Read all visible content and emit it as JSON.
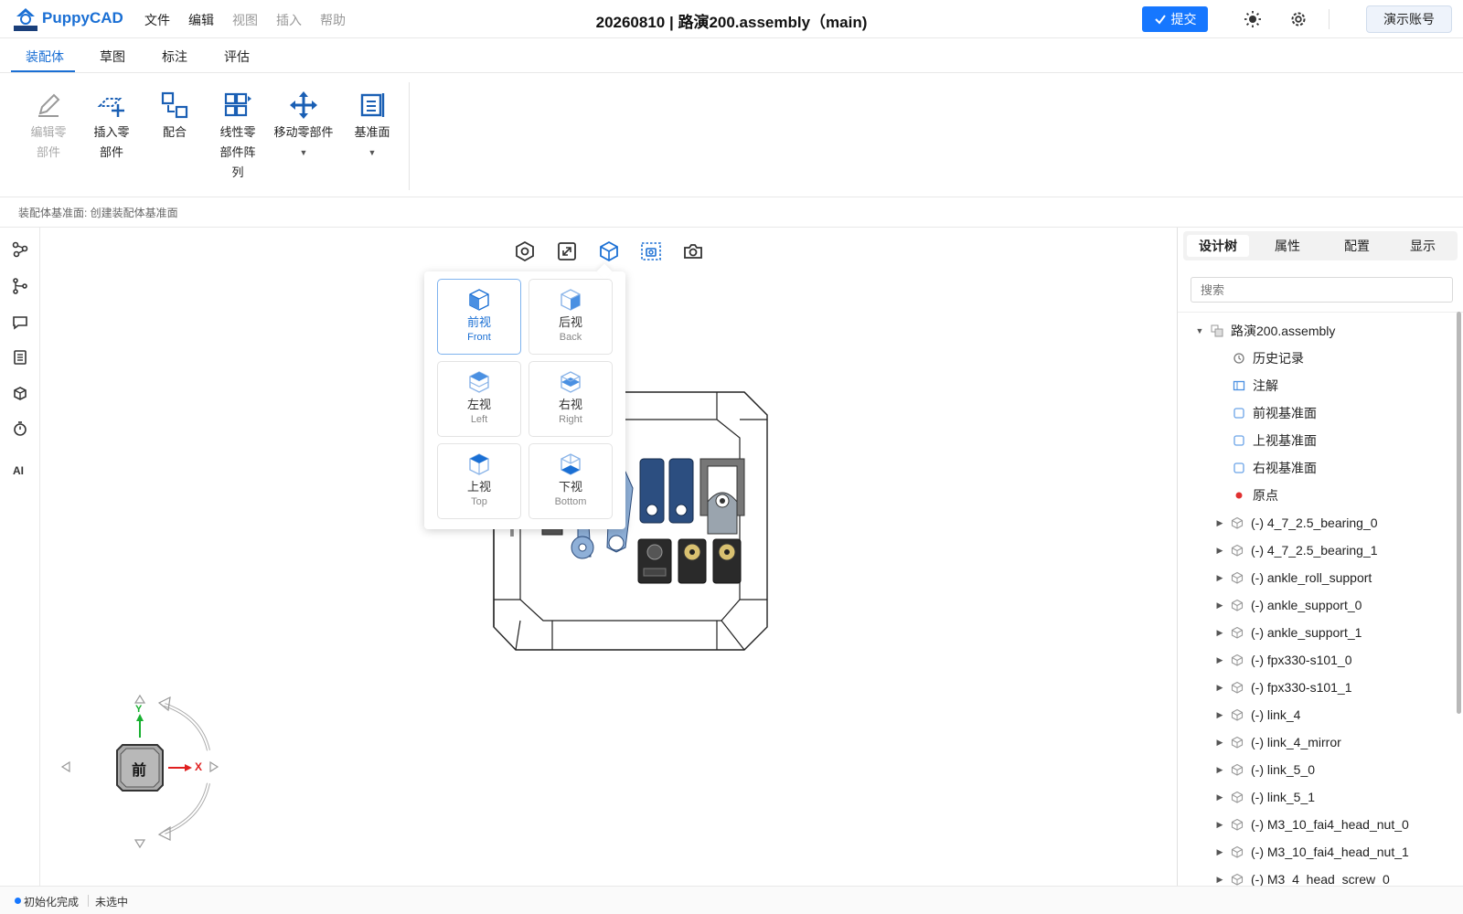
{
  "header": {
    "logo_text": "PuppyCAD",
    "menu": [
      {
        "label": "文件",
        "enabled": true
      },
      {
        "label": "编辑",
        "enabled": true
      },
      {
        "label": "视图",
        "enabled": false
      },
      {
        "label": "插入",
        "enabled": false
      },
      {
        "label": "帮助",
        "enabled": false
      }
    ],
    "doc_title": "20260810 | 路演200.assembly（main)",
    "submit_label": "提交",
    "account_label": "演示账号",
    "accent": "#1677ff"
  },
  "tabs": [
    {
      "label": "装配体",
      "active": true
    },
    {
      "label": "草图",
      "active": false
    },
    {
      "label": "标注",
      "active": false
    },
    {
      "label": "评估",
      "active": false
    }
  ],
  "ribbon": {
    "edit_part": {
      "line1": "编辑零",
      "line2": "部件",
      "enabled": false
    },
    "insert_part": {
      "line1": "插入零",
      "line2": "部件"
    },
    "mate": {
      "line1": "配合"
    },
    "linear_pattern": {
      "line1": "线性零",
      "line2": "部件阵",
      "line3": "列"
    },
    "move_part": {
      "line1": "移动零部件"
    },
    "datum_plane": {
      "line1": "基准面"
    }
  },
  "hint": "装配体基准面: 创建装配体基准面",
  "left_tools": {
    "ai_label": "AI"
  },
  "view_popup": {
    "views": [
      {
        "cn": "前视",
        "en": "Front",
        "active": true
      },
      {
        "cn": "后视",
        "en": "Back",
        "active": false
      },
      {
        "cn": "左视",
        "en": "Left",
        "active": false
      },
      {
        "cn": "右视",
        "en": "Right",
        "active": false
      },
      {
        "cn": "上视",
        "en": "Top",
        "active": false
      },
      {
        "cn": "下视",
        "en": "Bottom",
        "active": false
      }
    ]
  },
  "view_cube": {
    "face_label": "前",
    "x_label": "X",
    "y_label": "Y",
    "x_color": "#e02020",
    "y_color": "#18b030"
  },
  "right_panel": {
    "tabs": [
      {
        "label": "设计树",
        "active": true
      },
      {
        "label": "属性",
        "active": false
      },
      {
        "label": "配置",
        "active": false
      },
      {
        "label": "显示",
        "active": false
      }
    ],
    "search_placeholder": "搜索",
    "root": "路演200.assembly",
    "features": [
      {
        "label": "历史记录",
        "icon": "history-icon"
      },
      {
        "label": "注解",
        "icon": "annotation-icon"
      },
      {
        "label": "前视基准面",
        "icon": "plane-icon"
      },
      {
        "label": "上视基准面",
        "icon": "plane-icon"
      },
      {
        "label": "右视基准面",
        "icon": "plane-icon"
      },
      {
        "label": "原点",
        "icon": "origin-icon"
      }
    ],
    "parts": [
      "(-) 4_7_2.5_bearing_0",
      "(-) 4_7_2.5_bearing_1",
      "(-) ankle_roll_support",
      "(-) ankle_support_0",
      "(-) ankle_support_1",
      "(-) fpx330-s101_0",
      "(-) fpx330-s101_1",
      "(-) link_4",
      "(-) link_4_mirror",
      "(-) link_5_0",
      "(-) link_5_1",
      "(-) M3_10_fai4_head_nut_0",
      "(-) M3_10_fai4_head_nut_1",
      "(-) M3_4_head_screw_0"
    ]
  },
  "status": {
    "state": "初始化完成",
    "selection": "未选中"
  }
}
